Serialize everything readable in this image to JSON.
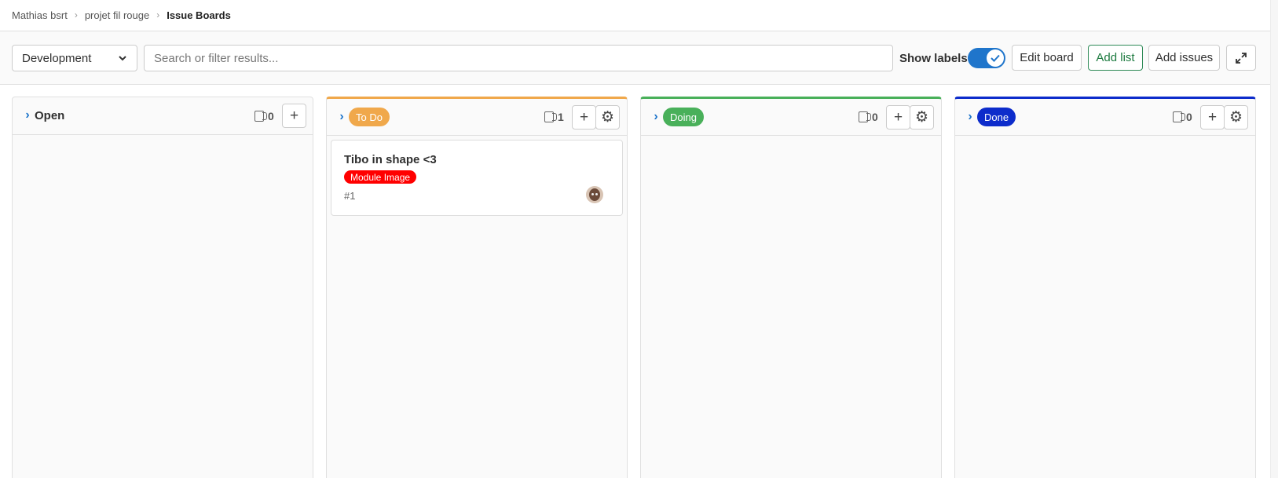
{
  "breadcrumb": {
    "items": [
      "Mathias bsrt",
      "projet fil rouge",
      "Issue Boards"
    ]
  },
  "toolbar": {
    "board_select": "Development",
    "search_placeholder": "Search or filter results...",
    "show_labels": "Show labels",
    "show_labels_on": true,
    "edit_board": "Edit board",
    "add_list": "Add list",
    "add_issues": "Add issues"
  },
  "lists": [
    {
      "title": "Open",
      "count": "0",
      "color": ""
    },
    {
      "title": "To Do",
      "count": "1",
      "color": "#f0a84b"
    },
    {
      "title": "Doing",
      "count": "0",
      "color": "#49b05a"
    },
    {
      "title": "Done",
      "count": "0",
      "color": "#0d2ccb"
    }
  ],
  "card": {
    "title": "Tibo in shape <3",
    "label": "Module Image",
    "label_color": "#ff0000",
    "ref": "#1"
  },
  "icons": {
    "chevron": "›",
    "plus": "+",
    "gear": "⚙"
  }
}
